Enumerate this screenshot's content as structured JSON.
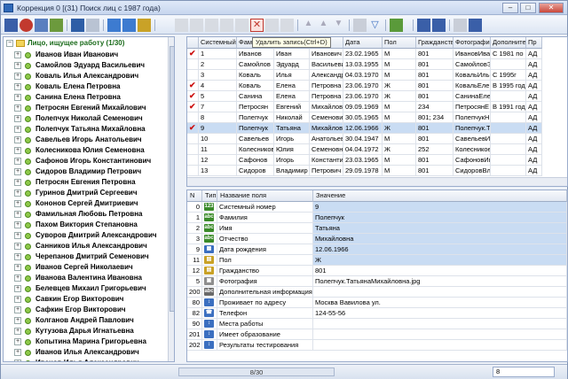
{
  "window": {
    "title": "Коррекция 0 [(31) Поиск лиц с 1987 года)",
    "min": "–",
    "max": "□",
    "close": "✕"
  },
  "tooltip": "Удалить запись(Ctrl+D)",
  "tree": {
    "root": "Лицо, ищущее работу (1/30)",
    "items": [
      "Иванов Иван Иванович",
      "Самойлов Эдуард Васильевич",
      "Коваль Илья Александрович",
      "Коваль Елена Петровна",
      "Санина Елена Петровна",
      "Петросян Евгений Михайлович",
      "Полепчук Николай Семенович",
      "Полепчук Татьяна Михайловна",
      "Савельев Игорь Анатольевич",
      "Колесникова Юлия Семеновна",
      "Сафонов Игорь Константинович",
      "Сидоров Владимир Петрович",
      "Петросян Евгения Петровна",
      "Гуринов Дмитрий Сергеевич",
      "Кононов Сергей Дмитриевич",
      "Фамильная Любовь Петровна",
      "Пахом Виктория Степановна",
      "Суворов Дмитрий Александрович",
      "Санников Илья Александрович",
      "Черепанов Дмитрий Семенович",
      "Иванов Сергей Николаевич",
      "Иванова Валентина Ивановна",
      "Белевцев Михаил Григорьевич",
      "Савкин Егор Викторович",
      "Сафкин Егор Викторович",
      "Колганов Андрей Павлович",
      "Кутузова Дарья Игнатьевна",
      "Копытина Марина Григорьевна",
      "Иванов Илья Александрович",
      "Иванов Илья Александрович"
    ]
  },
  "grid": {
    "headers": [
      "",
      "Системный",
      "Фам",
      "",
      "о",
      "Дата",
      "Пол",
      "Гражданство",
      "Фотографи",
      "Дополнител",
      "Пр"
    ],
    "rows": [
      {
        "chk": "✔",
        "c": [
          "1",
          "Иванов",
          "Иван",
          "Иванович",
          "23.02.1965",
          "М",
          "801",
          "ИвановИва",
          "С 1981 по",
          "АД"
        ]
      },
      {
        "chk": "",
        "c": [
          "2",
          "Самойлов",
          "Эдуард",
          "Васильевич",
          "13.03.1955",
          "М",
          "801",
          "СамойловЭ",
          "",
          "АД"
        ]
      },
      {
        "chk": "",
        "c": [
          "3",
          "Коваль",
          "Илья",
          "Александр",
          "04.03.1970",
          "М",
          "801",
          "КовальИль",
          "С 1995г",
          "АД"
        ]
      },
      {
        "chk": "✔",
        "c": [
          "4",
          "Коваль",
          "Елена",
          "Петровна",
          "23.06.1970",
          "Ж",
          "801",
          "КовальЕлен",
          "В 1995 году",
          "АД"
        ]
      },
      {
        "chk": "✔",
        "c": [
          "5",
          "Санина",
          "Елена",
          "Петровна",
          "23.06.1970",
          "Ж",
          "801",
          "СанинаЕле",
          "",
          "АД"
        ]
      },
      {
        "chk": "✔",
        "c": [
          "7",
          "Петросян",
          "Евгений",
          "Михайлович",
          "09.09.1969",
          "М",
          "234",
          "ПетросянЕ",
          "В 1991 году",
          "АД"
        ]
      },
      {
        "chk": "",
        "c": [
          "8",
          "Полепчук",
          "Николай",
          "Семенович",
          "30.05.1965",
          "М",
          "801; 234",
          "ПолепчукН",
          "",
          "АД"
        ]
      },
      {
        "chk": "✔",
        "c": [
          "9",
          "Полепчук",
          "Татьяна",
          "Михайловна",
          "12.06.1966",
          "Ж",
          "801",
          "Полепчук.Т",
          "",
          "АД"
        ]
      },
      {
        "chk": "",
        "c": [
          "10",
          "Савельев",
          "Игорь",
          "Анатольевич",
          "30.04.1947",
          "М",
          "801",
          "СавельевИг",
          "",
          "АД"
        ]
      },
      {
        "chk": "",
        "c": [
          "11",
          "Колесникова",
          "Юлия",
          "Семеновна",
          "04.04.1972",
          "Ж",
          "252",
          "Колесникое",
          "",
          "АД"
        ]
      },
      {
        "chk": "",
        "c": [
          "12",
          "Сафонов",
          "Игорь",
          "Константин",
          "23.03.1965",
          "М",
          "801",
          "СафоновИг",
          "",
          "АД"
        ]
      },
      {
        "chk": "",
        "c": [
          "13",
          "Сидоров",
          "Владимир",
          "Петрович",
          "29.09.1978",
          "М",
          "801",
          "СидоровВл",
          "",
          "АД"
        ]
      }
    ]
  },
  "detail": {
    "headers": [
      "N",
      "Тип",
      "Название поля",
      "Значение"
    ],
    "rows": [
      {
        "n": "0",
        "t": "123",
        "tc": "#3a8a2a",
        "name": "Системный номер",
        "val": "9"
      },
      {
        "n": "1",
        "t": "abc",
        "tc": "#3a8a2a",
        "name": "Фамилия",
        "val": "Полепчук"
      },
      {
        "n": "2",
        "t": "abc",
        "tc": "#3a8a2a",
        "name": "Имя",
        "val": "Татьяна"
      },
      {
        "n": "3",
        "t": "abc",
        "tc": "#3a8a2a",
        "name": "Отчество",
        "val": "Михайловна"
      },
      {
        "n": "9",
        "t": "▦",
        "tc": "#3b6fc0",
        "name": "Дата рождения",
        "val": "12.06.1966"
      },
      {
        "n": "11",
        "t": "▤",
        "tc": "#c9a227",
        "name": "Пол",
        "val": "Ж"
      },
      {
        "n": "12",
        "t": "▤",
        "tc": "#c9a227",
        "name": "Гражданство",
        "val": "801"
      },
      {
        "n": "5",
        "t": "▣",
        "tc": "#8f8f8f",
        "name": "Фотография",
        "val": "Полепчук.ТатьянаМихайловна.jpg"
      },
      {
        "n": "200",
        "t": "abc",
        "tc": "#6a6a6a",
        "name": "Дополнительная информация",
        "val": ""
      },
      {
        "n": "80",
        "t": "↕",
        "tc": "#3b6fc0",
        "name": "Проживает по адресу",
        "val": "Москва Вавилова ул."
      },
      {
        "n": "82",
        "t": "☎",
        "tc": "#3b6fc0",
        "name": "Телефон",
        "val": "124-55-56"
      },
      {
        "n": "90",
        "t": "↕",
        "tc": "#3b6fc0",
        "name": "Места работы",
        "val": ""
      },
      {
        "n": "201",
        "t": "↕",
        "tc": "#3b6fc0",
        "name": "Имеет образование",
        "val": ""
      },
      {
        "n": "202",
        "t": "↕",
        "tc": "#3b6fc0",
        "name": "Результаты тестирования",
        "val": ""
      }
    ]
  },
  "status": {
    "progress": "8/30",
    "box": "8"
  }
}
